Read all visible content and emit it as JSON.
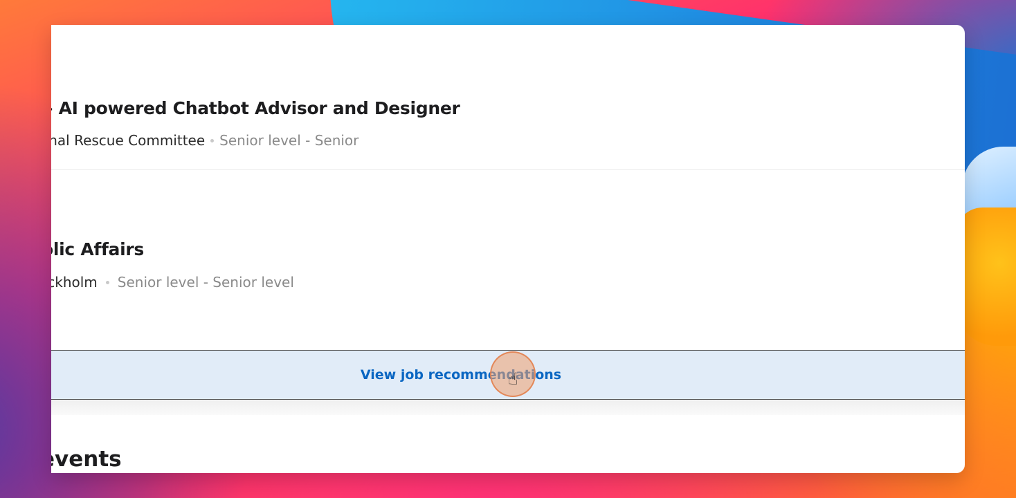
{
  "jobs": [
    {
      "title": "– AI powered Chatbot Advisor and Designer",
      "company": "onal Rescue Committee",
      "level": "Senior level - Senior"
    },
    {
      "title": "olic Affairs",
      "company": "ockholm",
      "level": "Senior level - Senior level"
    }
  ],
  "view_recommendations_label": "View job recommendations",
  "next_section_title": "events",
  "colors": {
    "link": "#0a66c2",
    "bar_background": "#e1ecf8",
    "cursor_highlight": "#f0a06e"
  },
  "icons": {
    "cursor": "hand-pointer-icon"
  }
}
